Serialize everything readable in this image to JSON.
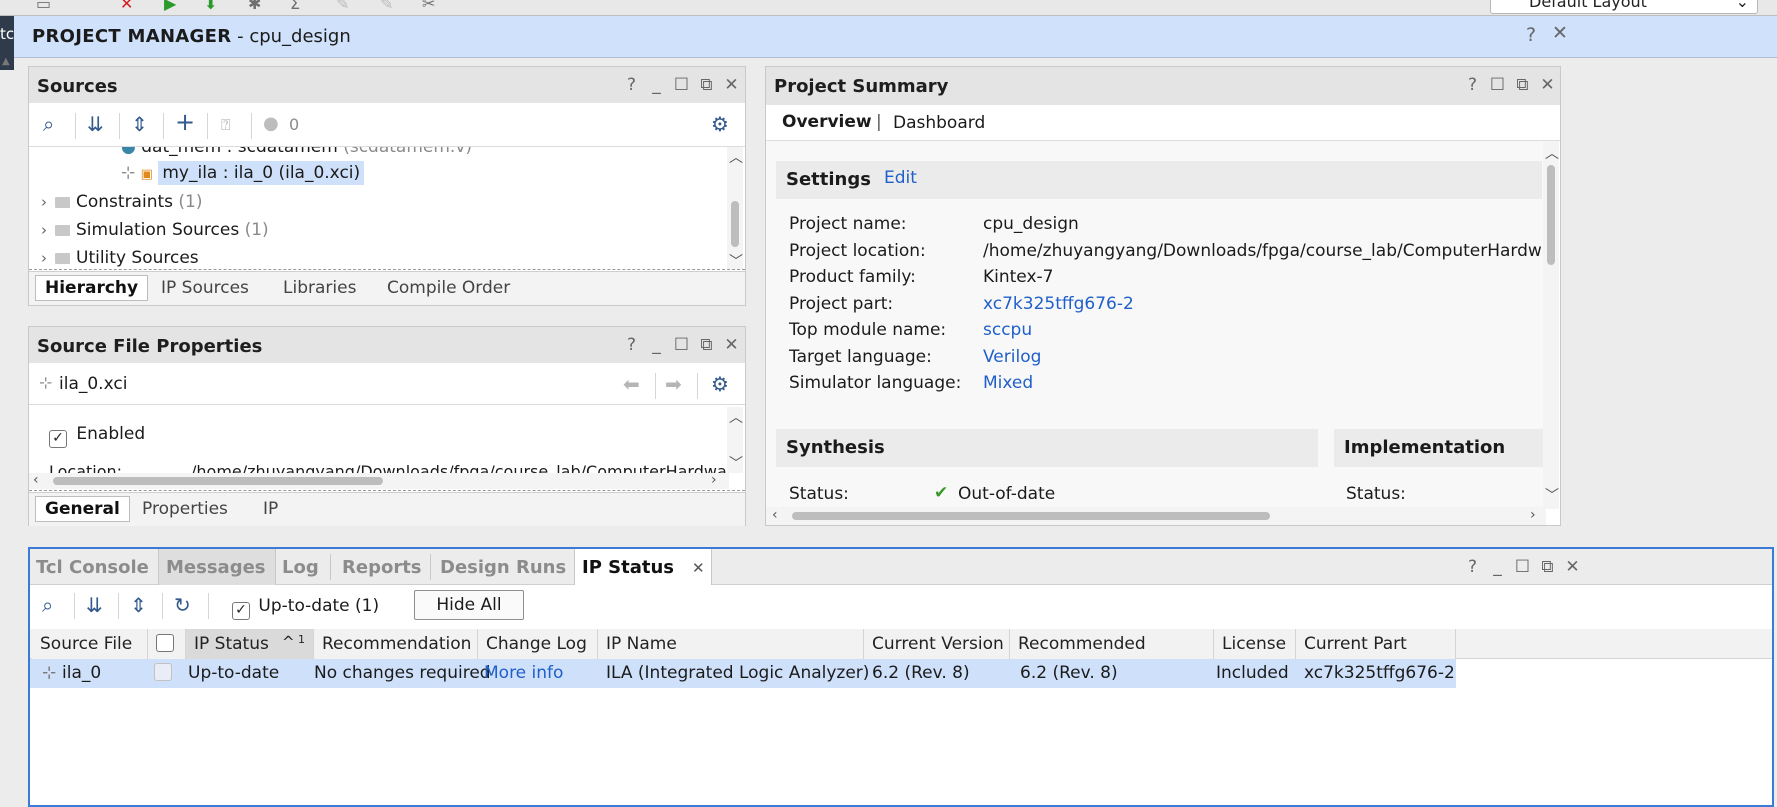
{
  "top_strip": {
    "layout_combo_value": "Default Layout",
    "left_tab_fragment": "tc"
  },
  "project_manager": {
    "title_bold": "PROJECT MANAGER",
    "title_rest": " - cpu_design"
  },
  "sources": {
    "title": "Sources",
    "badge_count": "0",
    "tree": {
      "row_cut_name": "dat_mem : scdatamem",
      "row_cut_file": "(scdatamem.v)",
      "row_selected": "my_ila : ila_0 (ila_0.xci)",
      "constraints": "Constraints",
      "constraints_count": "(1)",
      "simulation": "Simulation Sources",
      "simulation_count": "(1)",
      "utility": "Utility Sources"
    },
    "tabs": [
      "Hierarchy",
      "IP Sources",
      "Libraries",
      "Compile Order"
    ]
  },
  "source_file_properties": {
    "title": "Source File Properties",
    "file": "ila_0.xci",
    "enabled_label": "Enabled",
    "location_label": "Location:",
    "location_value": "/home/zhuyangyang/Downloads/fpga/course_lab/ComputerHardware",
    "tabs": [
      "General",
      "Properties",
      "IP"
    ]
  },
  "project_summary": {
    "title": "Project Summary",
    "tab_overview": "Overview",
    "tab_sep": "|",
    "tab_dashboard": "Dashboard",
    "settings_title": "Settings",
    "edit_link": "Edit",
    "settings": [
      {
        "label": "Project name:",
        "value": "cpu_design",
        "is_link": false
      },
      {
        "label": "Project location:",
        "value": "/home/zhuyangyang/Downloads/fpga/course_lab/ComputerHardwareSys",
        "is_link": false
      },
      {
        "label": "Product family:",
        "value": "Kintex-7",
        "is_link": false
      },
      {
        "label": "Project part:",
        "value": "xc7k325tffg676-2",
        "is_link": true
      },
      {
        "label": "Top module name:",
        "value": "sccpu",
        "is_link": true
      },
      {
        "label": "Target language:",
        "value": "Verilog",
        "is_link": true
      },
      {
        "label": "Simulator language:",
        "value": "Mixed",
        "is_link": true
      }
    ],
    "synthesis_title": "Synthesis",
    "implementation_title": "Implementation",
    "synth_status_label": "Status:",
    "synth_status_value": "Out-of-date",
    "impl_status_label": "Status:"
  },
  "bottom_panel": {
    "tabs": [
      "Tcl Console",
      "Messages",
      "Log",
      "Reports",
      "Design Runs",
      "IP Status"
    ],
    "active_tab": "IP Status",
    "uptodate_label": "Up-to-date (1)",
    "hide_all": "Hide All",
    "columns": [
      "Source File",
      "IP Status",
      "Recommendation",
      "Change Log",
      "IP Name",
      "Current Version",
      "Recommended Version",
      "License",
      "Current Part"
    ],
    "sort_indicator": "^",
    "sort_index": "1",
    "row": {
      "source_file": "ila_0",
      "ip_status": "Up-to-date",
      "recommendation": "No changes required",
      "change_log": "More info",
      "ip_name": "ILA (Integrated Logic Analyzer)",
      "current_version": "6.2 (Rev. 8)",
      "recommended_version": "6.2 (Rev. 8)",
      "license": "Included",
      "current_part": "xc7k325tffg676-2"
    }
  },
  "colors": {
    "accent": "#3b7ad6",
    "header_bg": "#cfe1fb",
    "selection": "#cfe0fa",
    "link": "#1f5fc9"
  }
}
